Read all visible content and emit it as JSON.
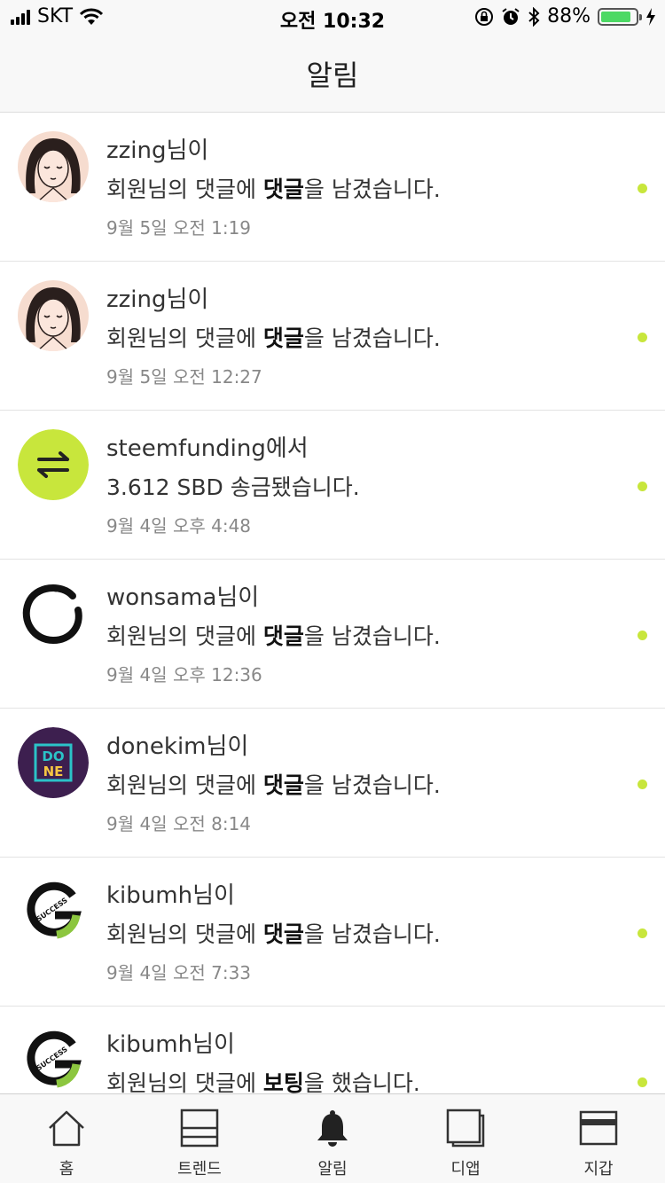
{
  "status_bar": {
    "carrier": "SKT",
    "time": "오전 10:32",
    "battery": "88%",
    "battery_level": 0.88
  },
  "header": {
    "title": "알림"
  },
  "notifications": [
    {
      "user": "zzing",
      "suffix": "님이",
      "text_before": "회원님의 댓글에 ",
      "text_bold": "댓글",
      "text_after": "을 남겼습니다.",
      "time": "9월 5일 오전 1:19",
      "avatar": "face-sketch-avatar"
    },
    {
      "user": "zzing",
      "suffix": "님이",
      "text_before": "회원님의 댓글에 ",
      "text_bold": "댓글",
      "text_after": "을 남겼습니다.",
      "time": "9월 5일 오전 12:27",
      "avatar": "face-sketch-avatar"
    },
    {
      "user": "steemfunding",
      "suffix": "에서",
      "text_before": "3.612 SBD 송금됐습니다.",
      "text_bold": "",
      "text_after": "",
      "time": "9월 4일 오후 4:48",
      "avatar": "transfer-arrows-icon"
    },
    {
      "user": "wonsama",
      "suffix": "님이",
      "text_before": "회원님의 댓글에 ",
      "text_bold": "댓글",
      "text_after": "을 남겼습니다.",
      "time": "9월 4일 오후 12:36",
      "avatar": "ink-circle-avatar"
    },
    {
      "user": "donekim",
      "suffix": "님이",
      "text_before": "회원님의 댓글에 ",
      "text_bold": "댓글",
      "text_after": "을 남겼습니다.",
      "time": "9월 4일 오전 8:14",
      "avatar": "done-logo-avatar"
    },
    {
      "user": "kibumh",
      "suffix": "님이",
      "text_before": "회원님의 댓글에 ",
      "text_bold": "댓글",
      "text_after": "을 남겼습니다.",
      "time": "9월 4일 오전 7:33",
      "avatar": "success-logo-avatar"
    },
    {
      "user": "kibumh",
      "suffix": "님이",
      "text_before": "회원님의 댓글에 ",
      "text_bold": "보팅",
      "text_after": "을 했습니다.",
      "time": "",
      "avatar": "success-logo-avatar"
    }
  ],
  "done_logo": {
    "top": "DO",
    "bottom": "NE"
  },
  "success_logo": {
    "text": "SUCCESS"
  },
  "tabs": [
    {
      "label": "홈",
      "icon": "home-icon"
    },
    {
      "label": "트렌드",
      "icon": "trend-icon"
    },
    {
      "label": "알림",
      "icon": "bell-icon"
    },
    {
      "label": "디앱",
      "icon": "dapp-icon"
    },
    {
      "label": "지갑",
      "icon": "wallet-icon"
    }
  ],
  "colors": {
    "unread_dot": "#c8e63c",
    "accent": "#c8e63c"
  }
}
